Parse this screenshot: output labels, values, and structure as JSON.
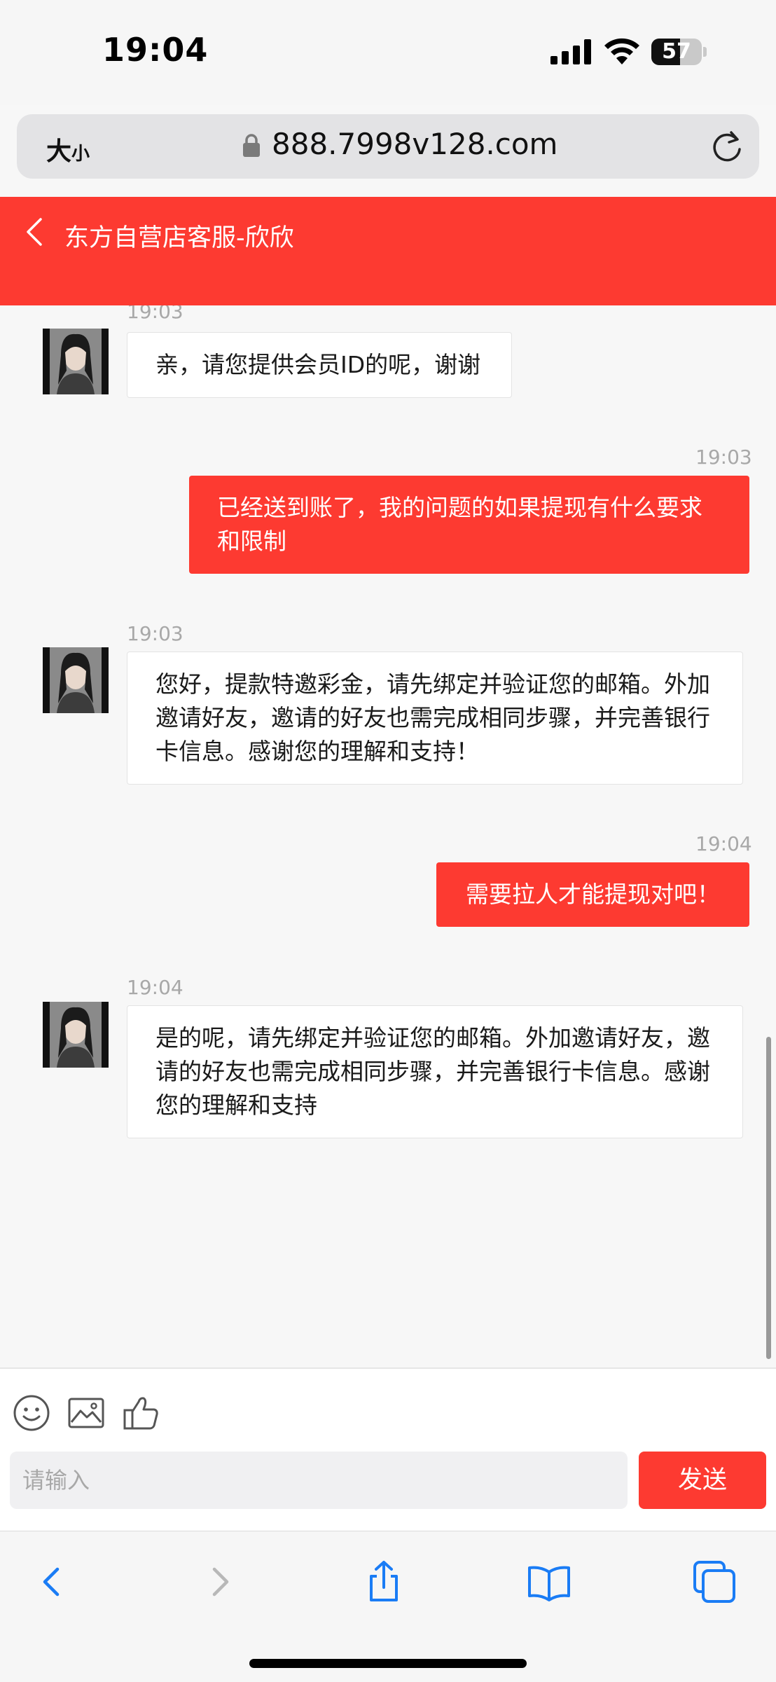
{
  "status_bar": {
    "time": "19:04",
    "battery": "57",
    "battery_level": 0.57
  },
  "browser": {
    "text_size_large": "大",
    "text_size_small": "小",
    "url": "888.7998v128.com"
  },
  "chat": {
    "title": "东方自营店客服-欣欣",
    "messages": [
      {
        "side": "in",
        "time": "19:03",
        "text": "亲，请您提供会员ID的呢，谢谢"
      },
      {
        "side": "out",
        "time": "19:03",
        "text": "已经送到账了，我的问题的如果提现有什么要求和限制"
      },
      {
        "side": "in",
        "time": "19:03",
        "text": "您好，提款特邀彩金，请先绑定并验证您的邮箱。外加邀请好友，邀请的好友也需完成相同步骤，并完善银行卡信息。感谢您的理解和支持！"
      },
      {
        "side": "out",
        "time": "19:04",
        "text": "需要拉人才能提现对吧！"
      },
      {
        "side": "in",
        "time": "19:04",
        "text": "是的呢，请先绑定并验证您的邮箱。外加邀请好友，邀请的好友也需完成相同步骤，并完善银行卡信息。感谢您的理解和支持"
      }
    ]
  },
  "composer": {
    "placeholder": "请输入",
    "send_label": "发送",
    "tools": [
      "emoji-icon",
      "image-icon",
      "thumbs-up-icon"
    ]
  },
  "colors": {
    "accent": "#fd3a31",
    "background": "#f7f7f7",
    "timestamp": "#a8a8a8",
    "link_blue": "#1a7cf5"
  }
}
